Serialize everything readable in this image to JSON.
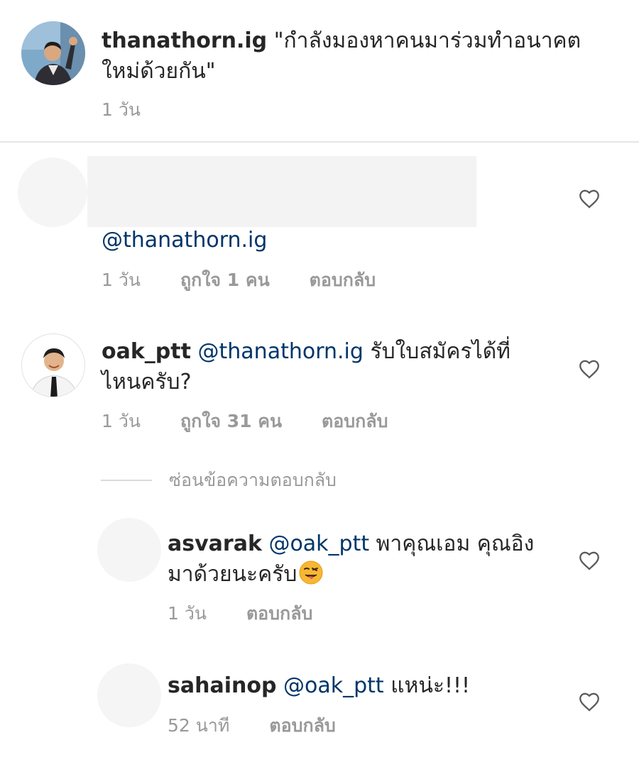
{
  "post": {
    "username": "thanathorn.ig",
    "caption_line1": "\"กำลังมองหาคนมาร่วมทำอนาคต",
    "caption_line2": "ใหม่ด้วยกัน\"",
    "time": "1 วัน"
  },
  "comments": [
    {
      "mention": "@thanathorn.ig",
      "time": "1 วัน",
      "likes": "ถูกใจ 1 คน",
      "reply": "ตอบกลับ"
    },
    {
      "username": "oak_ptt",
      "mention": "@thanathorn.ig",
      "text_line1": " รับใบสมัครได้ที่",
      "text_line2": "ไหนครับ?",
      "time": "1 วัน",
      "likes": "ถูกใจ 31 คน",
      "reply": "ตอบกลับ",
      "hide_replies": "ซ่อนข้อความตอบกลับ"
    }
  ],
  "replies": [
    {
      "username": "asvarak",
      "mention": "@oak_ptt",
      "text_line1": "  พาคุณเอม คุณอิง",
      "text_line2": "มาด้วยนะครับ",
      "time": "1 วัน",
      "reply": "ตอบกลับ"
    },
    {
      "username": "sahainop",
      "mention": "@oak_ptt",
      "text_line1": " แหน่ะ!!!",
      "time": "52 นาที",
      "reply": "ตอบกลับ"
    }
  ],
  "icons": {
    "heart": "heart-outline-icon",
    "emoji": "winking-tongue-face-emoji"
  },
  "colors": {
    "text": "#262626",
    "mention": "#003569",
    "meta": "#999999",
    "divider": "#e6e6e6"
  }
}
